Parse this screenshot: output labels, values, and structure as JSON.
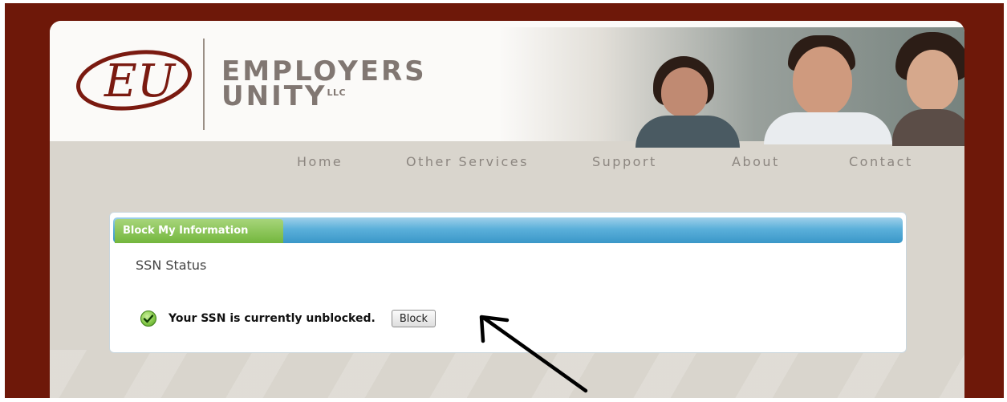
{
  "brand": {
    "logo_text": "EU",
    "name_line1": "EMPLOYERS",
    "name_line2": "UNITY",
    "suffix": "LLC"
  },
  "nav": {
    "items": [
      {
        "label": "Home"
      },
      {
        "label": "Other Services"
      },
      {
        "label": "Support"
      },
      {
        "label": "About"
      },
      {
        "label": "Contact"
      }
    ]
  },
  "panel": {
    "tab_label": "Block My Information",
    "section_title": "SSN Status",
    "status_icon": "check-circle-icon",
    "status_message": "Your SSN is currently unblocked.",
    "block_button_label": "Block"
  },
  "colors": {
    "frame": "#6e1809",
    "tab_green": "#73b63d",
    "bar_blue": "#3a97c8",
    "brand_gray": "#817772"
  }
}
